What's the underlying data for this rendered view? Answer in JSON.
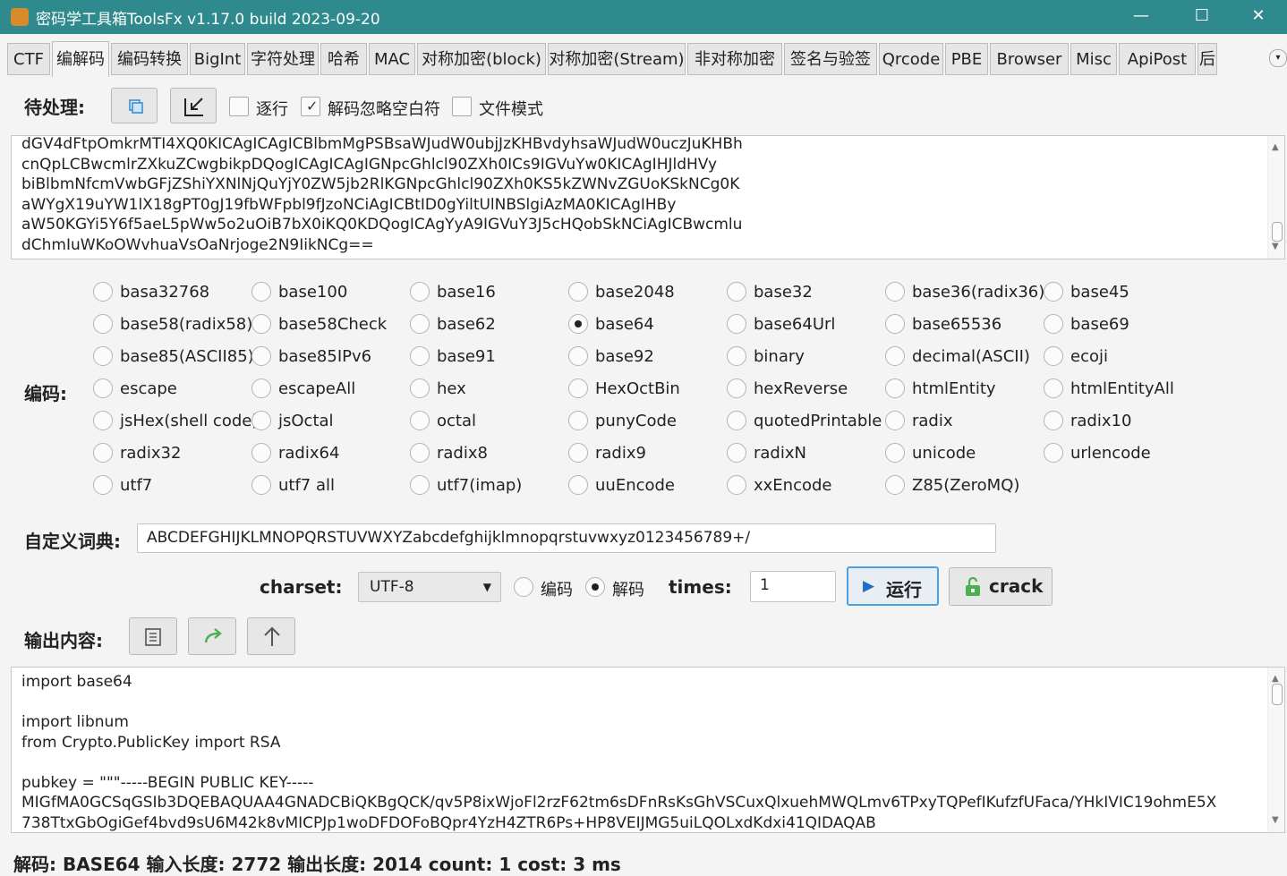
{
  "window": {
    "title": "密码学工具箱ToolsFx v1.17.0 build 2023-09-20",
    "minimize_glyph": "—",
    "maximize_glyph": "☐",
    "close_glyph": "✕"
  },
  "tabs": [
    "CTF",
    "编解码",
    "编码转换",
    "BigInt",
    "字符处理",
    "哈希",
    "MAC",
    "对称加密(block)",
    "对称加密(Stream)",
    "非对称加密",
    "签名与验签",
    "Qrcode",
    "PBE",
    "Browser",
    "Misc",
    "ApiPost",
    "后"
  ],
  "active_tab": "编解码",
  "input_section": {
    "label": "待处理:",
    "options": [
      {
        "label": "逐行",
        "checked": false
      },
      {
        "label": "解码忽略空白符",
        "checked": true
      },
      {
        "label": "文件模式",
        "checked": false
      }
    ],
    "lines": [
      "dGV4dFtpOmkrMTI4XQ0KICAgICAgICBlbmMgPSBsaWJudW0ubjJzKHBvdyhsaWJudW0uczJuKHBh",
      "cnQpLCBwcmlrZXkuZCwgbikpDQogICAgICAgIGNpcGhlcl90ZXh0ICs9IGVuYw0KICAgIHJldHVy",
      "biBlbmNfcmVwbGFjZShiYXNlNjQuYjY0ZW5jb2RlKGNpcGhlcl90ZXh0KS5kZWNvZGUoKSkNCg0K",
      "aWYgX19uYW1lX18gPT0gJ19fbWFpbl9fJzoNCiAgICBtID0gYiltUlNBSlgiAzMA0KICAgIHBy",
      "aW50KGYi5Y6f5aeL5pWw5o2uOiB7bX0iKQ0KDQogICAgYyA9IGVuY3J5cHQobSkNCiAgICBwcmlu",
      "dChmIuWKoOWvhuaVsOaNrjoge2N9IikNCg=="
    ]
  },
  "encoding": {
    "label": "编码:",
    "selected": "base64",
    "options": [
      [
        "basa32768",
        "base100",
        "base16",
        "base2048",
        "base32",
        "base36(radix36)",
        "base45"
      ],
      [
        "base58(radix58)",
        "base58Check",
        "base62",
        "base64",
        "base64Url",
        "base65536",
        "base69"
      ],
      [
        "base85(ASCII85)",
        "base85IPv6",
        "base91",
        "base92",
        "binary",
        "decimal(ASCII)",
        "ecoji"
      ],
      [
        "escape",
        "escapeAll",
        "hex",
        "HexOctBin",
        "hexReverse",
        "htmlEntity",
        "htmlEntityAll"
      ],
      [
        "jsHex(shell code)",
        "jsOctal",
        "octal",
        "punyCode",
        "quotedPrintable",
        "radix",
        "radix10"
      ],
      [
        "radix32",
        "radix64",
        "radix8",
        "radix9",
        "radixN",
        "unicode",
        "urlencode"
      ],
      [
        "utf7",
        "utf7 all",
        "utf7(imap)",
        "uuEncode",
        "xxEncode",
        "Z85(ZeroMQ)"
      ]
    ]
  },
  "dictionary": {
    "label": "自定义词典:",
    "value": "ABCDEFGHIJKLMNOPQRSTUVWXYZabcdefghijklmnopqrstuvwxyz0123456789+/"
  },
  "controls": {
    "charset_label": "charset:",
    "charset_value": "UTF-8",
    "encode_label": "编码",
    "decode_label": "解码",
    "mode": "decode",
    "times_label": "times:",
    "times_value": "1",
    "run_label": "运行",
    "crack_label": "crack"
  },
  "output_section": {
    "label": "输出内容:",
    "lines": [
      "import base64",
      "",
      "import libnum",
      "from Crypto.PublicKey import RSA",
      "",
      "pubkey = \"\"\"-----BEGIN PUBLIC KEY-----",
      "MIGfMA0GCSqGSIb3DQEBAQUAA4GNADCBiQKBgQCK/qv5P8ixWjoFl2rzF62tm6sDFnRsKsGhVSCuxQlxuehMWQLmv6TPxyTQPefIKufzfUFaca/YHkIVIC19ohmE5X",
      "738TtxGbOgiGef4bvd9sU6M42k8vMICPJp1woDFDOFoBQpr4YzH4ZTR6Ps+HP8VEIJMG5uiLQOLxdKdxi41QIDAQAB"
    ]
  },
  "status_bar": "解码: BASE64  输入长度: 2772  输出长度: 2014 count: 1 cost: 3 ms",
  "colors": {
    "titlebar": "#2f8a8d",
    "run_button_border": "#4aa3df",
    "crack_icon": "#4caf50"
  }
}
